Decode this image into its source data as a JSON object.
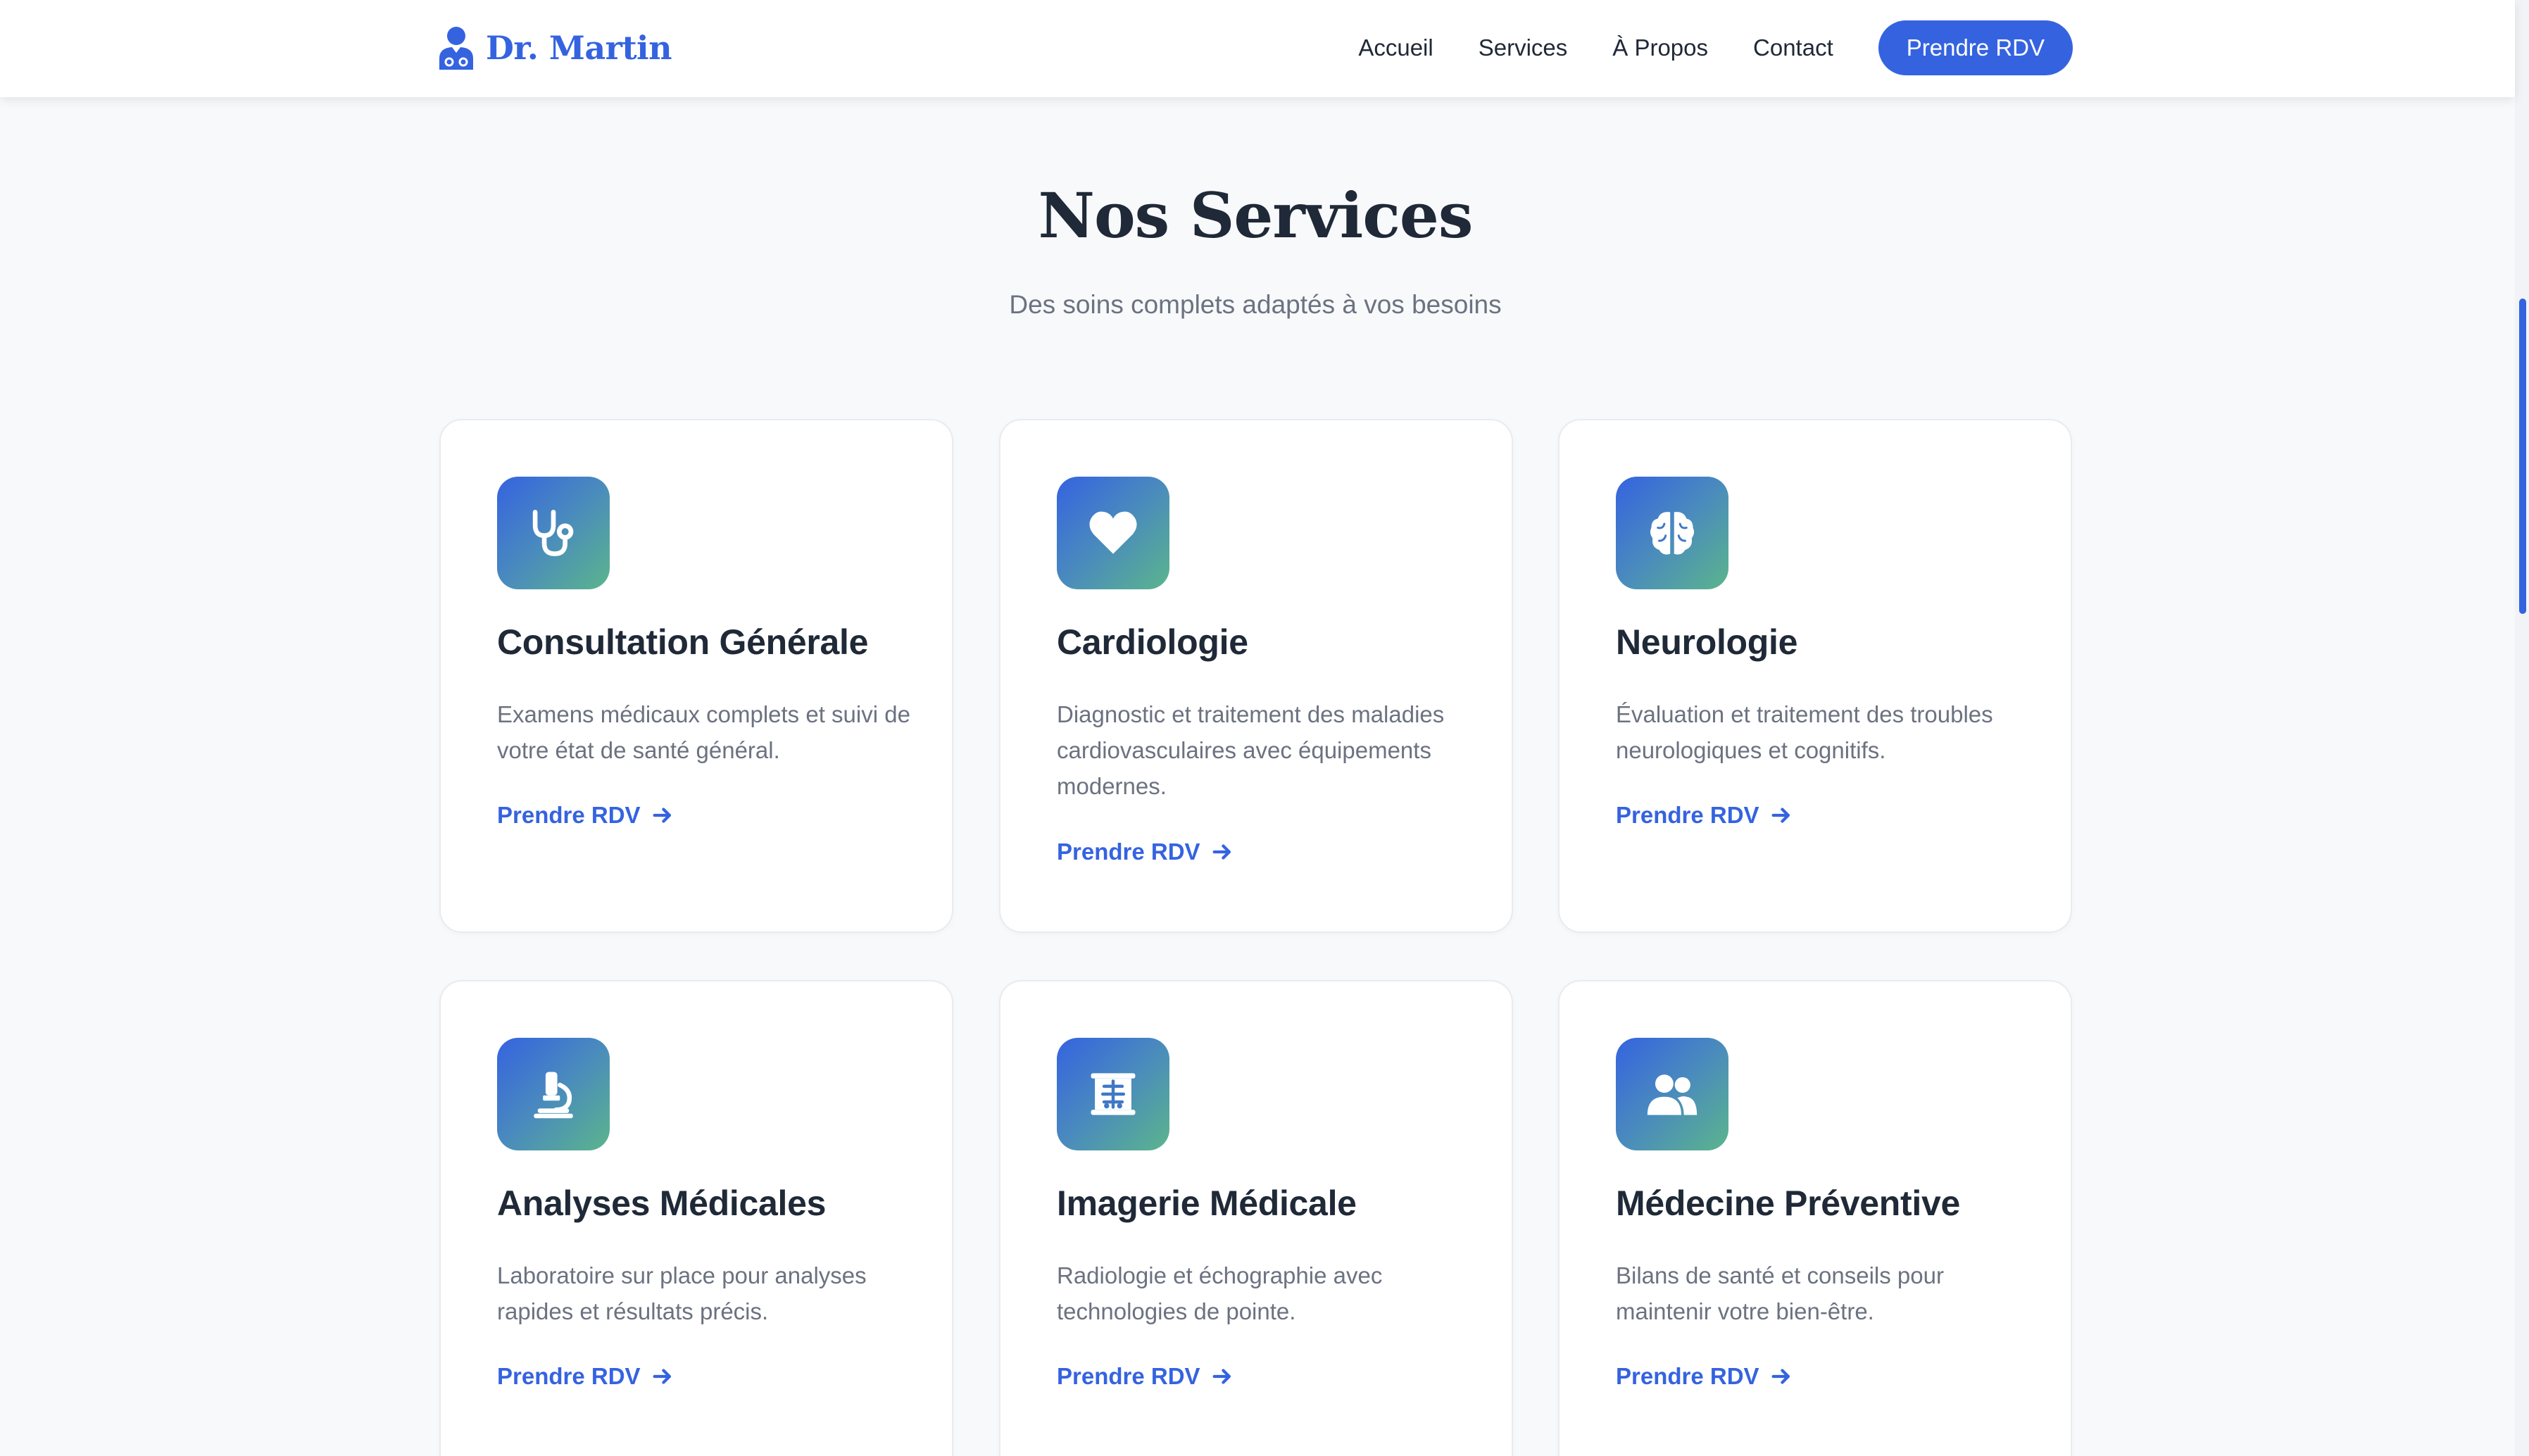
{
  "header": {
    "logo_text": "Dr. Martin",
    "logo_icon": "doctor-icon",
    "nav": [
      "Accueil",
      "Services",
      "À Propos",
      "Contact"
    ],
    "cta_label": "Prendre RDV"
  },
  "section": {
    "title": "Nos Services",
    "subtitle": "Des soins complets adaptés à vos besoins"
  },
  "cards": [
    {
      "icon": "stethoscope-icon",
      "title": "Consultation Générale",
      "description": "Examens médicaux complets et suivi de votre état de santé général.",
      "link": "Prendre RDV"
    },
    {
      "icon": "heart-icon",
      "title": "Cardiologie",
      "description": "Diagnostic et traitement des maladies cardiovasculaires avec équipements modernes.",
      "link": "Prendre RDV"
    },
    {
      "icon": "brain-icon",
      "title": "Neurologie",
      "description": "Évaluation et traitement des troubles neurologiques et cognitifs.",
      "link": "Prendre RDV"
    },
    {
      "icon": "microscope-icon",
      "title": "Analyses Médicales",
      "description": "Laboratoire sur place pour analyses rapides et résultats précis.",
      "link": "Prendre RDV"
    },
    {
      "icon": "x-ray-icon",
      "title": "Imagerie Médicale",
      "description": "Radiologie et échographie avec technologies de pointe.",
      "link": "Prendre RDV"
    },
    {
      "icon": "users-icon",
      "title": "Médecine Préventive",
      "description": "Bilans de santé et conseils pour maintenir votre bien-être.",
      "link": "Prendre RDV"
    }
  ],
  "colors": {
    "accent": "#3563e0",
    "gradient_end": "#5bb58c",
    "text": "#1f2937",
    "muted": "#6b7280",
    "background": "#f8f9fb"
  }
}
